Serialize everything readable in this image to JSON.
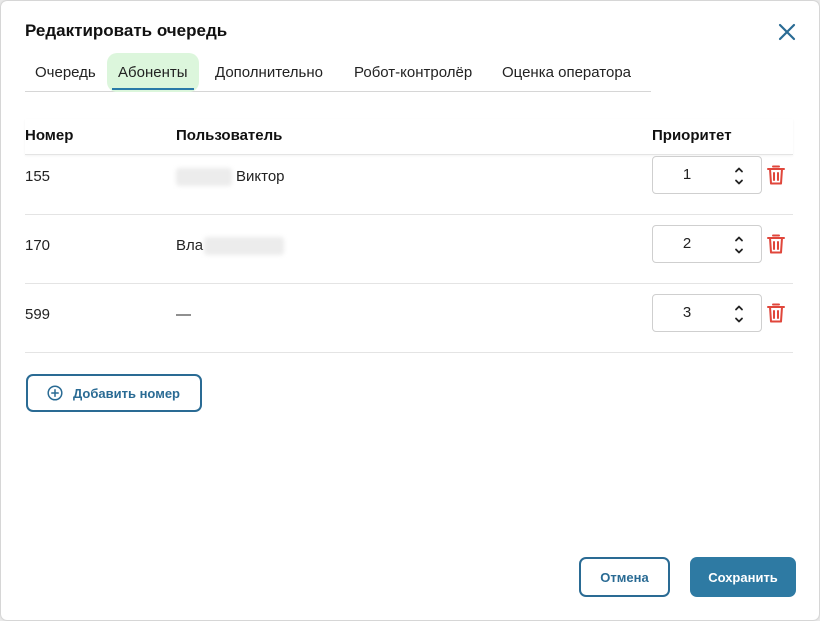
{
  "dialog": {
    "title": "Редактировать очередь",
    "close_icon": "close-icon"
  },
  "tabs": [
    {
      "label": "Очередь",
      "active": false
    },
    {
      "label": "Абоненты",
      "active": true
    },
    {
      "label": "Дополнительно",
      "active": false
    },
    {
      "label": "Робот-контролёр",
      "active": false
    },
    {
      "label": "Оценка оператора",
      "active": false
    }
  ],
  "table": {
    "headers": {
      "number": "Номер",
      "user": "Пользователь",
      "priority": "Приоритет"
    },
    "rows": [
      {
        "number": "155",
        "user_visible": "Виктор",
        "priority": "1"
      },
      {
        "number": "170",
        "user_visible": "Вла",
        "priority": "2"
      },
      {
        "number": "599",
        "user_visible": "—",
        "priority": "3"
      }
    ]
  },
  "actions": {
    "add_number": "Добавить номер",
    "cancel": "Отмена",
    "save": "Сохранить"
  },
  "colors": {
    "accent": "#2a6b94",
    "primary_button": "#2e7aa3",
    "active_tab_bg": "#dcf6dc",
    "delete": "#e0463b"
  }
}
